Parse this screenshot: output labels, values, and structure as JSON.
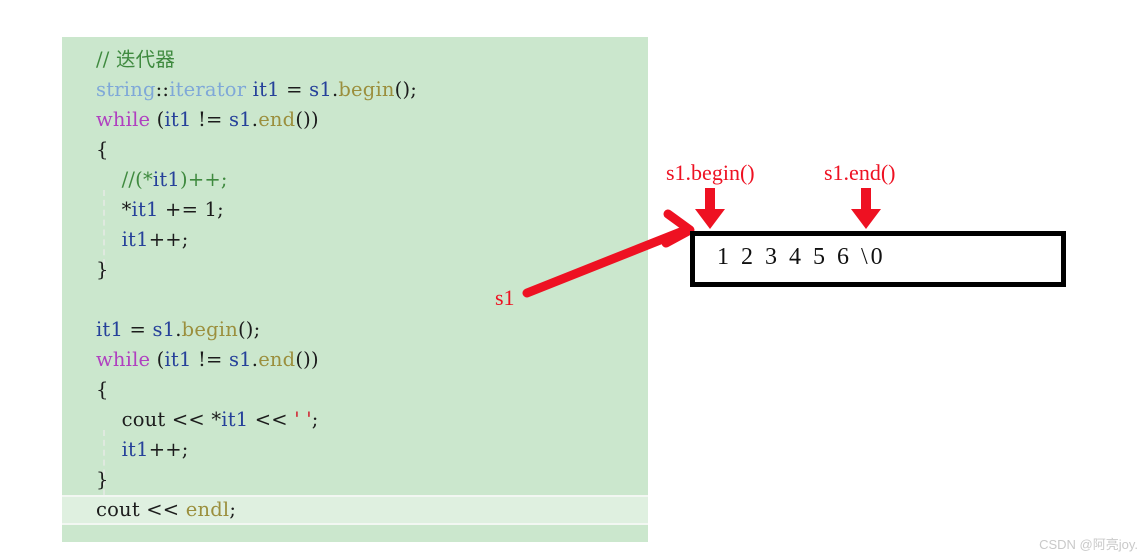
{
  "code": {
    "language": "cpp",
    "background_color": "#cbe7cd",
    "highlight_color": "#dff0e0",
    "lines": [
      {
        "id": 1,
        "text": "// 迭代器",
        "highlight": false,
        "tokens": [
          {
            "t": "// 迭代器",
            "c": "t-comment"
          }
        ]
      },
      {
        "id": 2,
        "text": "string::iterator it1 = s1.begin();",
        "highlight": false,
        "tokens": [
          {
            "t": "string",
            "c": "t-type"
          },
          {
            "t": "::",
            "c": "t-plain"
          },
          {
            "t": "iterator",
            "c": "t-type"
          },
          {
            "t": " ",
            "c": "t-plain"
          },
          {
            "t": "it1",
            "c": "t-var"
          },
          {
            "t": " = ",
            "c": "t-plain"
          },
          {
            "t": "s1",
            "c": "t-var"
          },
          {
            "t": ".",
            "c": "t-plain"
          },
          {
            "t": "begin",
            "c": "t-func"
          },
          {
            "t": "();",
            "c": "t-plain"
          }
        ]
      },
      {
        "id": 3,
        "text": "while (it1 != s1.end())",
        "highlight": false,
        "tokens": [
          {
            "t": "while",
            "c": "t-keyword"
          },
          {
            "t": " (",
            "c": "t-plain"
          },
          {
            "t": "it1",
            "c": "t-var"
          },
          {
            "t": " != ",
            "c": "t-plain"
          },
          {
            "t": "s1",
            "c": "t-var"
          },
          {
            "t": ".",
            "c": "t-plain"
          },
          {
            "t": "end",
            "c": "t-func"
          },
          {
            "t": "())",
            "c": "t-plain"
          }
        ]
      },
      {
        "id": 4,
        "text": "{",
        "highlight": false,
        "tokens": [
          {
            "t": "{",
            "c": "t-plain"
          }
        ]
      },
      {
        "id": 5,
        "text": "    //(*it1)++;",
        "highlight": false,
        "tokens": [
          {
            "t": "    ",
            "c": "t-plain"
          },
          {
            "t": "//(*",
            "c": "t-comment"
          },
          {
            "t": "it1",
            "c": "t-var"
          },
          {
            "t": ")++;",
            "c": "t-comment"
          }
        ]
      },
      {
        "id": 6,
        "text": "    *it1 += 1;",
        "highlight": false,
        "tokens": [
          {
            "t": "    *",
            "c": "t-plain"
          },
          {
            "t": "it1",
            "c": "t-var"
          },
          {
            "t": " += 1;",
            "c": "t-plain"
          }
        ]
      },
      {
        "id": 7,
        "text": "    it1++;",
        "highlight": false,
        "tokens": [
          {
            "t": "    ",
            "c": "t-plain"
          },
          {
            "t": "it1",
            "c": "t-var"
          },
          {
            "t": "++;",
            "c": "t-plain"
          }
        ]
      },
      {
        "id": 8,
        "text": "}",
        "highlight": false,
        "tokens": [
          {
            "t": "}",
            "c": "t-plain"
          }
        ]
      },
      {
        "id": 9,
        "text": "",
        "highlight": false,
        "tokens": []
      },
      {
        "id": 10,
        "text": "it1 = s1.begin();",
        "highlight": false,
        "tokens": [
          {
            "t": "it1",
            "c": "t-var"
          },
          {
            "t": " = ",
            "c": "t-plain"
          },
          {
            "t": "s1",
            "c": "t-var"
          },
          {
            "t": ".",
            "c": "t-plain"
          },
          {
            "t": "begin",
            "c": "t-func"
          },
          {
            "t": "();",
            "c": "t-plain"
          }
        ]
      },
      {
        "id": 11,
        "text": "while (it1 != s1.end())",
        "highlight": false,
        "tokens": [
          {
            "t": "while",
            "c": "t-keyword"
          },
          {
            "t": " (",
            "c": "t-plain"
          },
          {
            "t": "it1",
            "c": "t-var"
          },
          {
            "t": " != ",
            "c": "t-plain"
          },
          {
            "t": "s1",
            "c": "t-var"
          },
          {
            "t": ".",
            "c": "t-plain"
          },
          {
            "t": "end",
            "c": "t-func"
          },
          {
            "t": "())",
            "c": "t-plain"
          }
        ]
      },
      {
        "id": 12,
        "text": "{",
        "highlight": false,
        "tokens": [
          {
            "t": "{",
            "c": "t-plain"
          }
        ]
      },
      {
        "id": 13,
        "text": "    cout << *it1 << ' ';",
        "highlight": false,
        "tokens": [
          {
            "t": "    cout << *",
            "c": "t-plain"
          },
          {
            "t": "it1",
            "c": "t-var"
          },
          {
            "t": " << ",
            "c": "t-plain"
          },
          {
            "t": "' '",
            "c": "t-string"
          },
          {
            "t": ";",
            "c": "t-plain"
          }
        ]
      },
      {
        "id": 14,
        "text": "    it1++;",
        "highlight": false,
        "tokens": [
          {
            "t": "    ",
            "c": "t-plain"
          },
          {
            "t": "it1",
            "c": "t-var"
          },
          {
            "t": "++;",
            "c": "t-plain"
          }
        ]
      },
      {
        "id": 15,
        "text": "}",
        "highlight": false,
        "tokens": [
          {
            "t": "}",
            "c": "t-plain"
          }
        ]
      },
      {
        "id": 16,
        "text": "cout << endl;",
        "highlight": true,
        "tokens": [
          {
            "t": "cout << ",
            "c": "t-plain"
          },
          {
            "t": "endl",
            "c": "t-func"
          },
          {
            "t": ";",
            "c": "t-plain"
          }
        ]
      }
    ]
  },
  "annotations": {
    "color": "#ee1122",
    "label_begin": "s1.begin()",
    "label_end": "s1.end()",
    "label_s1": "s1",
    "pointer_arrow_begin": "down-arrow-icon",
    "pointer_arrow_end": "down-arrow-icon",
    "pointer_arrow_s1": "diagonal-arrow-icon"
  },
  "memory_box": {
    "content": "1 2 3 4 5 6 \\0",
    "cells": [
      "1",
      "2",
      "3",
      "4",
      "5",
      "6",
      "\\0"
    ],
    "border_color": "#000000",
    "background_color": "#ffffff"
  },
  "watermark": {
    "text": "CSDN @阿亮joy."
  }
}
